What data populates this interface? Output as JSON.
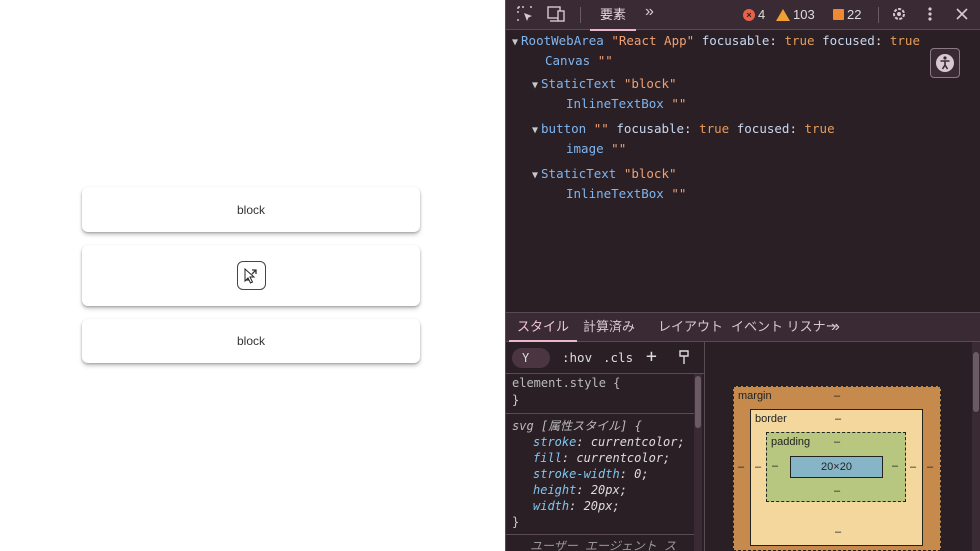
{
  "app": {
    "cards": [
      {
        "label": "block"
      },
      {
        "label": ""
      },
      {
        "label": "block"
      }
    ]
  },
  "devtools": {
    "toolbar": {
      "tab_label": "要素",
      "more": "»",
      "errors": "4",
      "warnings": "103",
      "issues": "22"
    },
    "tree": {
      "root": {
        "role": "RootWebArea",
        "name": "\"React App\"",
        "p1": "focusable",
        "v1": "true",
        "p2": "focused",
        "v2": "true"
      },
      "canvas": {
        "role": "Canvas",
        "name": "\"\""
      },
      "static1": {
        "role": "StaticText",
        "name": "\"block\""
      },
      "inline1": {
        "role": "InlineTextBox",
        "name": "\"\""
      },
      "button": {
        "role": "button",
        "name": "\"\"",
        "p1": "focusable",
        "v1": "true",
        "p2": "focused",
        "v2": "true"
      },
      "image": {
        "role": "image",
        "name": "\"\""
      },
      "static2": {
        "role": "StaticText",
        "name": "\"block\""
      },
      "inline2": {
        "role": "InlineTextBox",
        "name": "\"\""
      }
    },
    "lower_tabs": [
      "スタイル",
      "計算済み",
      "レイアウト",
      "イベント リスナー",
      "»"
    ],
    "styles": {
      "filter": "Y",
      "hov": ":hov",
      "cls": ".cls",
      "plus": "+",
      "element_style": "element.style {",
      "element_style_close": "}",
      "svg_selector": "svg [属性スタイル] {",
      "decls": [
        {
          "name": "stroke",
          "value": "currentcolor;"
        },
        {
          "name": "fill",
          "value": "currentcolor;"
        },
        {
          "name": "stroke-width",
          "value": "0;"
        },
        {
          "name": "height",
          "value": "20px;"
        },
        {
          "name": "width",
          "value": "20px;"
        }
      ],
      "svg_close": "}",
      "ua_label": "ユーザー エージェント ス"
    },
    "boxmodel": {
      "margin_label": "margin",
      "border_label": "border",
      "padding_label": "padding",
      "content": "20×20",
      "dash": "–"
    }
  }
}
